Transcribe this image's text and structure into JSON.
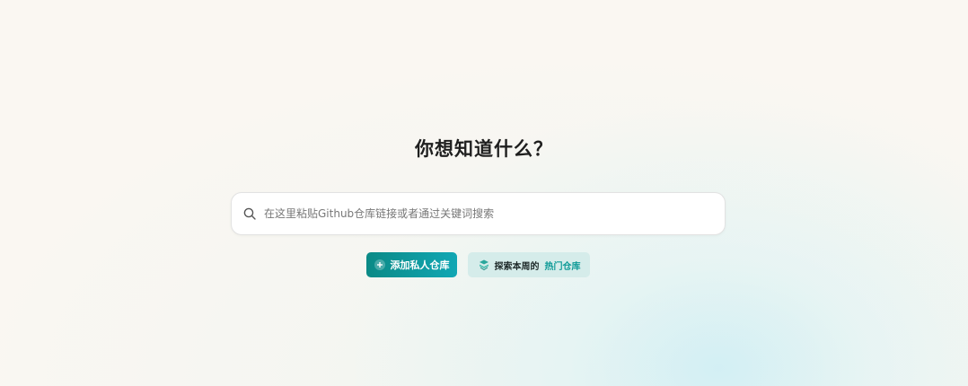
{
  "heading": "你想知道什么？",
  "search": {
    "placeholder": "在这里粘贴Github仓库链接或者通过关键词搜索",
    "value": "",
    "icon": "search-icon"
  },
  "actions": {
    "add_private_repo": {
      "label": "添加私人仓库",
      "icon": "plus-circle-icon"
    },
    "explore_hot": {
      "prefix": "探索本周的",
      "highlight": "热门仓库",
      "icon": "book-stack-icon"
    }
  },
  "colors": {
    "background": "#faf7f2",
    "accent": "#0b8a86",
    "accent_light": "#11a7b4",
    "explore_bg": "#d5ecea",
    "highlight_text": "#0e9a97"
  }
}
